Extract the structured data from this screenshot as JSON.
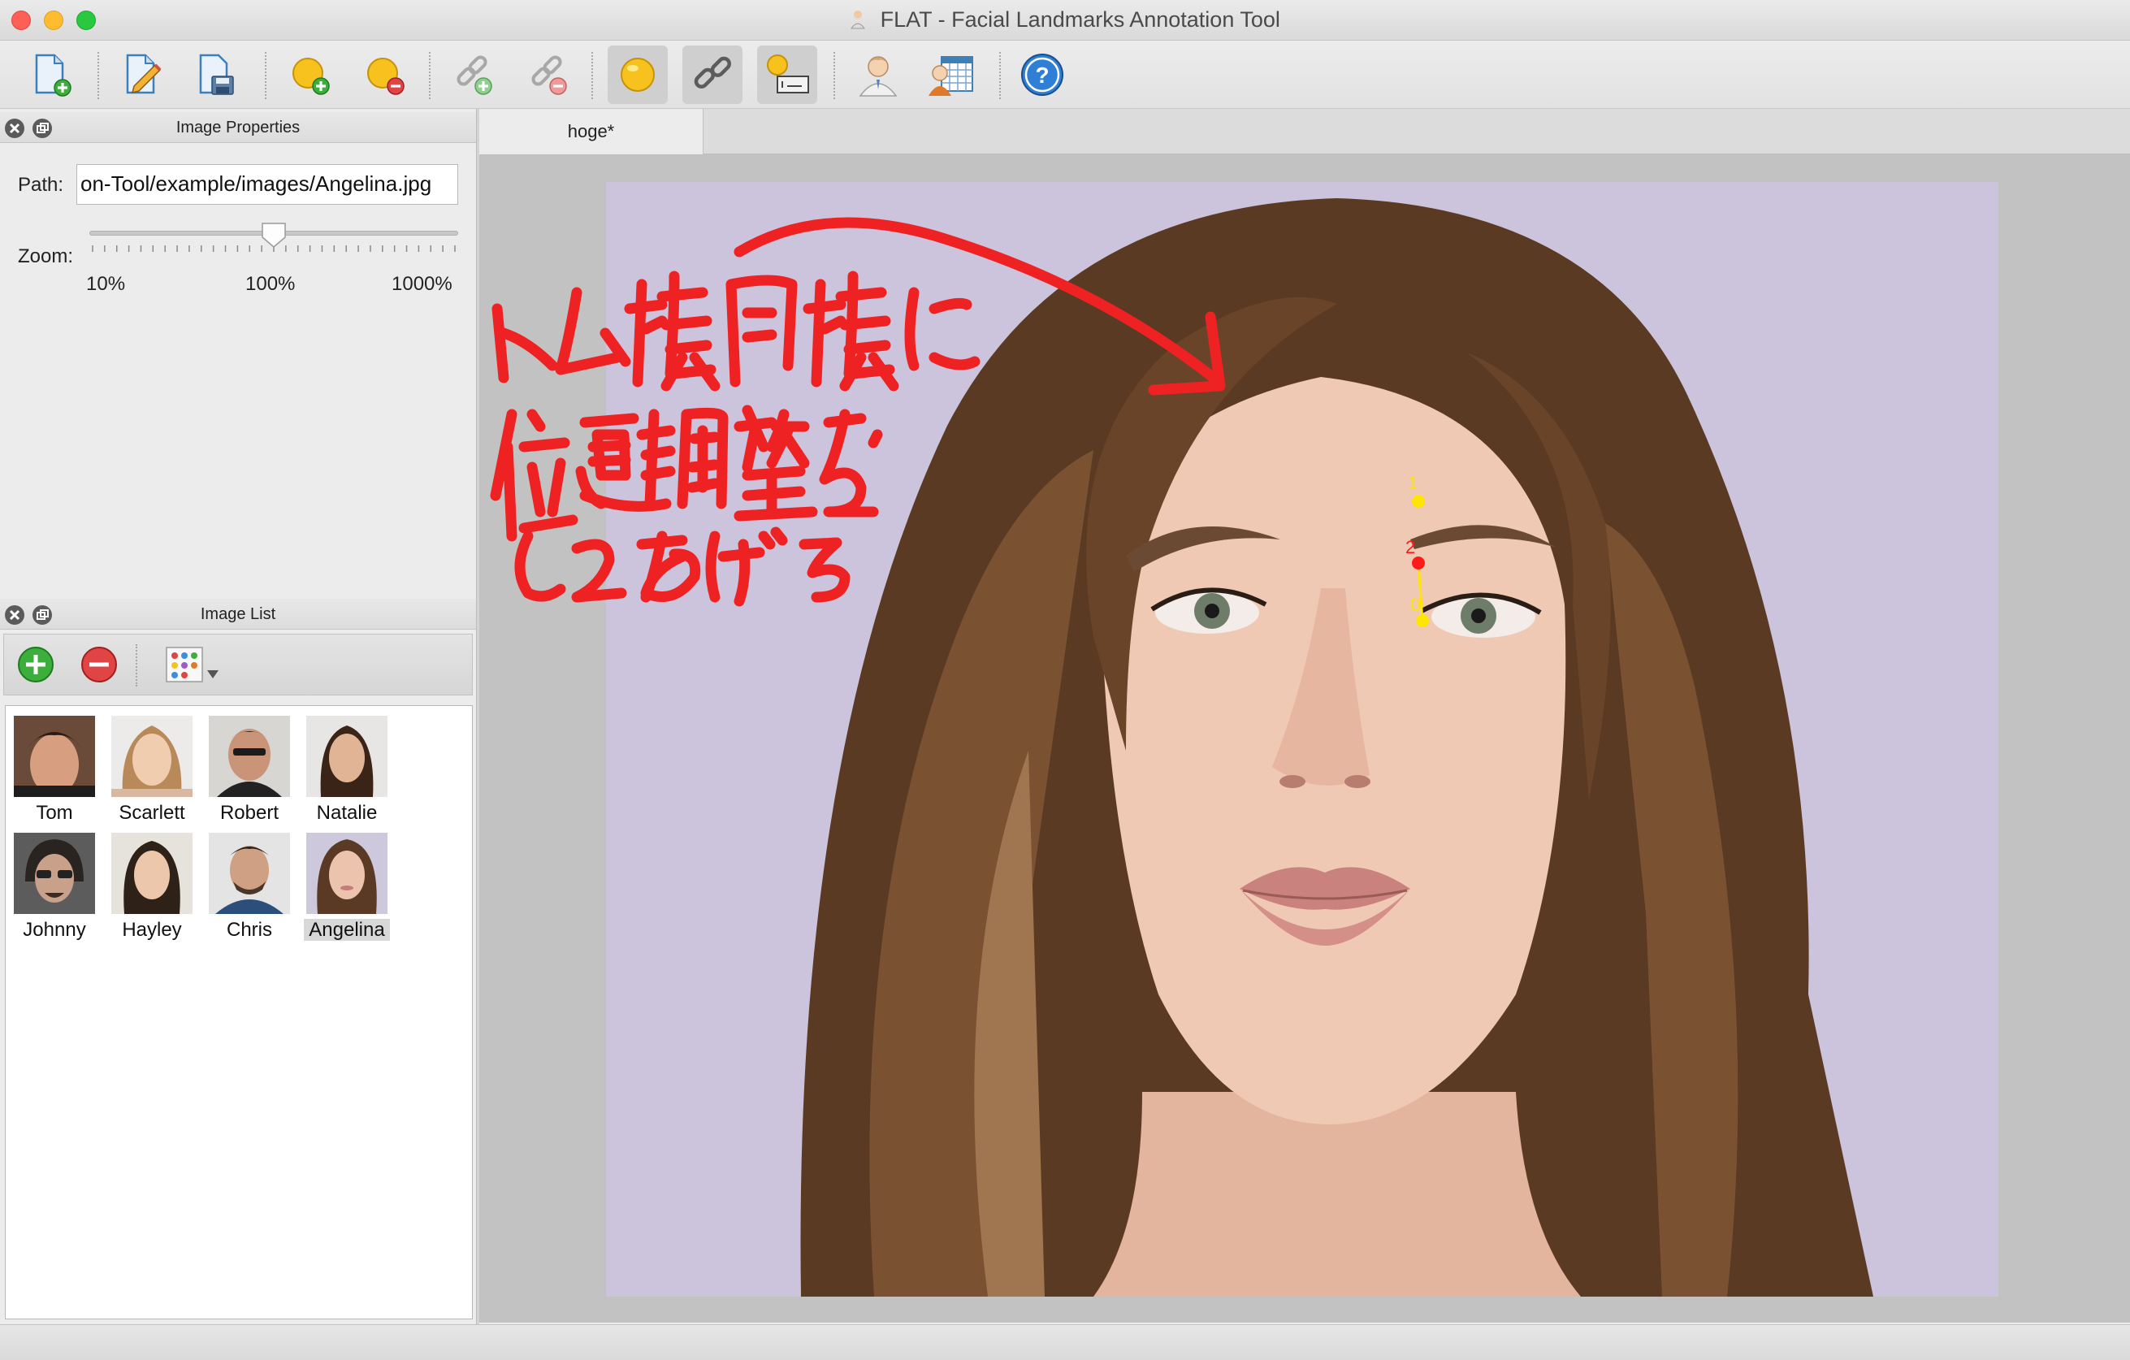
{
  "window": {
    "title": "FLAT - Facial Landmarks Annotation Tool"
  },
  "toolbar": {
    "buttons": [
      {
        "icon": "new-project-icon"
      },
      {
        "icon": "edit-project-icon"
      },
      {
        "icon": "save-project-icon"
      },
      {
        "icon": "add-landmark-icon"
      },
      {
        "icon": "remove-landmark-icon"
      },
      {
        "icon": "add-link-icon"
      },
      {
        "icon": "remove-link-icon"
      },
      {
        "icon": "draw-landmarks-icon",
        "active": true
      },
      {
        "icon": "draw-links-icon",
        "active": true
      },
      {
        "icon": "draw-ids-icon",
        "active": true
      },
      {
        "icon": "face-fit-icon"
      },
      {
        "icon": "batch-fit-icon"
      },
      {
        "icon": "help-icon"
      }
    ]
  },
  "image_properties": {
    "title": "Image Properties",
    "path_label": "Path:",
    "path_value": "on-Tool/example/images/Angelina.jpg",
    "zoom_label": "Zoom:",
    "zoom_min_label": "10%",
    "zoom_mid_label": "100%",
    "zoom_max_label": "1000%",
    "zoom_level": "100%"
  },
  "image_list": {
    "title": "Image List",
    "images": [
      {
        "name": "Tom",
        "selected": false
      },
      {
        "name": "Scarlett",
        "selected": false
      },
      {
        "name": "Robert",
        "selected": false
      },
      {
        "name": "Natalie",
        "selected": false
      },
      {
        "name": "Johnny",
        "selected": false
      },
      {
        "name": "Hayley",
        "selected": false
      },
      {
        "name": "Chris",
        "selected": false
      },
      {
        "name": "Angelina",
        "selected": true
      }
    ]
  },
  "tabs": [
    {
      "label": "hoge*",
      "active": true
    }
  ],
  "landmarks": [
    {
      "id": "1",
      "color": "#ffe600"
    },
    {
      "id": "2",
      "color": "#ff1a1a"
    },
    {
      "id": "0",
      "color": "#ffe600"
    }
  ],
  "annotation": {
    "handwritten_note": "トム様同様に 位置調整を してあげる",
    "color": "#ee2222"
  }
}
